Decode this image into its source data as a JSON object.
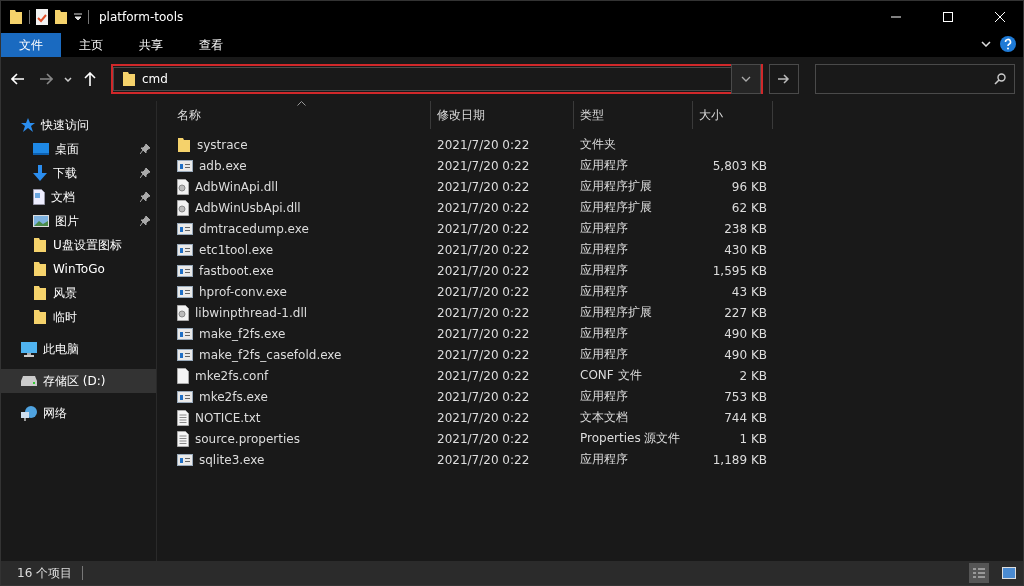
{
  "window": {
    "title": "platform-tools"
  },
  "ribbon_tabs": [
    {
      "label": "文件",
      "selected": true
    },
    {
      "label": "主页",
      "selected": false
    },
    {
      "label": "共享",
      "selected": false
    },
    {
      "label": "查看",
      "selected": false
    }
  ],
  "address": {
    "value": "cmd",
    "highlighted": true
  },
  "sidebar": {
    "items": [
      {
        "label": "快速访问",
        "kind": "star",
        "pinned": false,
        "selected": false,
        "children": [
          {
            "label": "桌面",
            "kind": "desktop",
            "pinned": true,
            "selected": false
          },
          {
            "label": "下载",
            "kind": "download",
            "pinned": true,
            "selected": false
          },
          {
            "label": "文档",
            "kind": "document",
            "pinned": true,
            "selected": false
          },
          {
            "label": "图片",
            "kind": "pictures",
            "pinned": true,
            "selected": false
          },
          {
            "label": "U盘设置图标",
            "kind": "folder",
            "pinned": false,
            "selected": false
          },
          {
            "label": "WinToGo",
            "kind": "folder",
            "pinned": false,
            "selected": false
          },
          {
            "label": "风景",
            "kind": "folder",
            "pinned": false,
            "selected": false
          },
          {
            "label": "临时",
            "kind": "folder",
            "pinned": false,
            "selected": false
          }
        ]
      },
      {
        "label": "此电脑",
        "kind": "computer",
        "pinned": false,
        "selected": false
      },
      {
        "label": "存储区 (D:)",
        "kind": "drive",
        "pinned": false,
        "selected": true
      },
      {
        "label": "网络",
        "kind": "network",
        "pinned": false,
        "selected": false
      }
    ]
  },
  "table": {
    "columns": [
      "名称",
      "修改日期",
      "类型",
      "大小"
    ],
    "rows": [
      {
        "name": "systrace",
        "kind": "folder",
        "date": "2021/7/20 0:22",
        "type": "文件夹"
      },
      {
        "name": "adb.exe",
        "kind": "exe",
        "date": "2021/7/20 0:22",
        "type": "应用程序",
        "size": "5,803 KB"
      },
      {
        "name": "AdbWinApi.dll",
        "kind": "dll",
        "date": "2021/7/20 0:22",
        "type": "应用程序扩展",
        "size": "96 KB"
      },
      {
        "name": "AdbWinUsbApi.dll",
        "kind": "dll",
        "date": "2021/7/20 0:22",
        "type": "应用程序扩展",
        "size": "62 KB"
      },
      {
        "name": "dmtracedump.exe",
        "kind": "exe",
        "date": "2021/7/20 0:22",
        "type": "应用程序",
        "size": "238 KB"
      },
      {
        "name": "etc1tool.exe",
        "kind": "exe",
        "date": "2021/7/20 0:22",
        "type": "应用程序",
        "size": "430 KB"
      },
      {
        "name": "fastboot.exe",
        "kind": "exe",
        "date": "2021/7/20 0:22",
        "type": "应用程序",
        "size": "1,595 KB"
      },
      {
        "name": "hprof-conv.exe",
        "kind": "exe",
        "date": "2021/7/20 0:22",
        "type": "应用程序",
        "size": "43 KB"
      },
      {
        "name": "libwinpthread-1.dll",
        "kind": "dll",
        "date": "2021/7/20 0:22",
        "type": "应用程序扩展",
        "size": "227 KB"
      },
      {
        "name": "make_f2fs.exe",
        "kind": "exe",
        "date": "2021/7/20 0:22",
        "type": "应用程序",
        "size": "490 KB"
      },
      {
        "name": "make_f2fs_casefold.exe",
        "kind": "exe",
        "date": "2021/7/20 0:22",
        "type": "应用程序",
        "size": "490 KB"
      },
      {
        "name": "mke2fs.conf",
        "kind": "blank",
        "date": "2021/7/20 0:22",
        "type": "CONF 文件",
        "size": "2 KB"
      },
      {
        "name": "mke2fs.exe",
        "kind": "exe",
        "date": "2021/7/20 0:22",
        "type": "应用程序",
        "size": "753 KB"
      },
      {
        "name": "NOTICE.txt",
        "kind": "text",
        "date": "2021/7/20 0:22",
        "type": "文本文档",
        "size": "744 KB"
      },
      {
        "name": "source.properties",
        "kind": "text",
        "date": "2021/7/20 0:22",
        "type": "Properties 源文件",
        "size": "1 KB"
      },
      {
        "name": "sqlite3.exe",
        "kind": "exe",
        "date": "2021/7/20 0:22",
        "type": "应用程序",
        "size": "1,189 KB"
      }
    ]
  },
  "status_bar": {
    "count": "16 个项目"
  }
}
